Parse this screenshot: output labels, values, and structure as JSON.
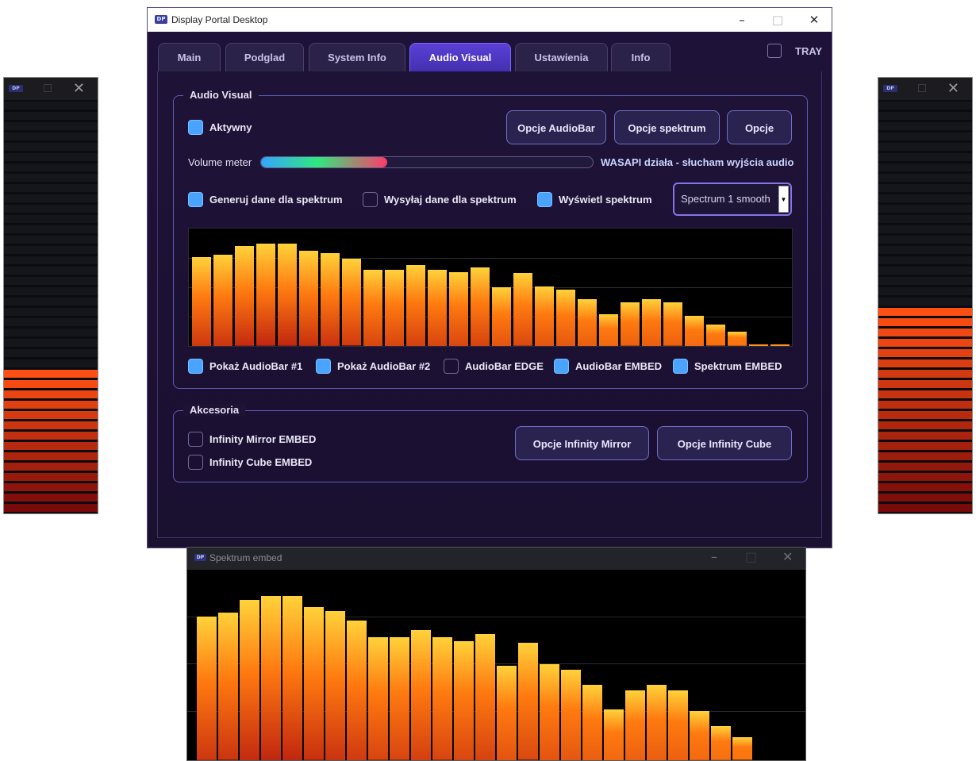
{
  "colors": {
    "accent": "#5a40d6",
    "checkbox_on": "#4aa4ff",
    "bar_top": "#ffd23a",
    "bar_bottom": "#b01010",
    "window_bg": "#1e1235"
  },
  "main_window": {
    "logo": "DP",
    "title": "Display Portal Desktop",
    "minimize_icon": "minimize-icon",
    "maximize_icon": "maximize-icon",
    "close_icon": "close-icon"
  },
  "tabs": [
    {
      "label": "Main",
      "active": false
    },
    {
      "label": "Podglad",
      "active": false
    },
    {
      "label": "System Info",
      "active": false
    },
    {
      "label": "Audio Visual",
      "active": true
    },
    {
      "label": "Ustawienia",
      "active": false
    },
    {
      "label": "Info",
      "active": false
    }
  ],
  "tray": {
    "label": "TRAY",
    "checked": false
  },
  "audio_visual": {
    "group_title": "Audio Visual",
    "aktywny": {
      "label": "Aktywny",
      "checked": true
    },
    "buttons": {
      "audiobar": "Opcje AudioBar",
      "spektrum": "Opcje spektrum",
      "opcje": "Opcje"
    },
    "volume": {
      "label": "Volume meter",
      "level": 0.38,
      "status": "WASAPI działa - słucham wyjścia audio"
    },
    "generuj": {
      "label": "Generuj dane dla spektrum",
      "checked": true
    },
    "wysylaj": {
      "label": "Wysyłaj dane dla spektrum",
      "checked": false
    },
    "wyswietl": {
      "label": "Wyświetl spektrum",
      "checked": true
    },
    "select": {
      "value": "Spectrum 1 smooth"
    },
    "embed_checks": [
      {
        "label": "Pokaż AudioBar #1",
        "checked": true
      },
      {
        "label": "Pokaż AudioBar #2",
        "checked": true
      },
      {
        "label": "AudioBar EDGE",
        "checked": false
      },
      {
        "label": "AudioBar EMBED",
        "checked": true
      },
      {
        "label": "Spektrum EMBED",
        "checked": true
      }
    ]
  },
  "akcesoria": {
    "group_title": "Akcesoria",
    "mirror": {
      "label": "Infinity Mirror EMBED",
      "checked": false
    },
    "cube": {
      "label": "Infinity Cube EMBED",
      "checked": false
    },
    "buttons": {
      "mirror": "Opcje Infinity Mirror",
      "cube": "Opcje Infinity Cube"
    }
  },
  "spectrum_levels": [
    0.76,
    0.78,
    0.85,
    0.87,
    0.87,
    0.81,
    0.79,
    0.74,
    0.65,
    0.65,
    0.69,
    0.65,
    0.63,
    0.67,
    0.5,
    0.62,
    0.51,
    0.48,
    0.4,
    0.27,
    0.37,
    0.4,
    0.37,
    0.26,
    0.18,
    0.12,
    0.01,
    0.01
  ],
  "audiobar_left": {
    "logo": "DP",
    "level": 0.34
  },
  "audiobar_right": {
    "logo": "DP",
    "level": 0.49
  },
  "embed_window": {
    "logo": "DP",
    "title": "Spektrum embed"
  }
}
